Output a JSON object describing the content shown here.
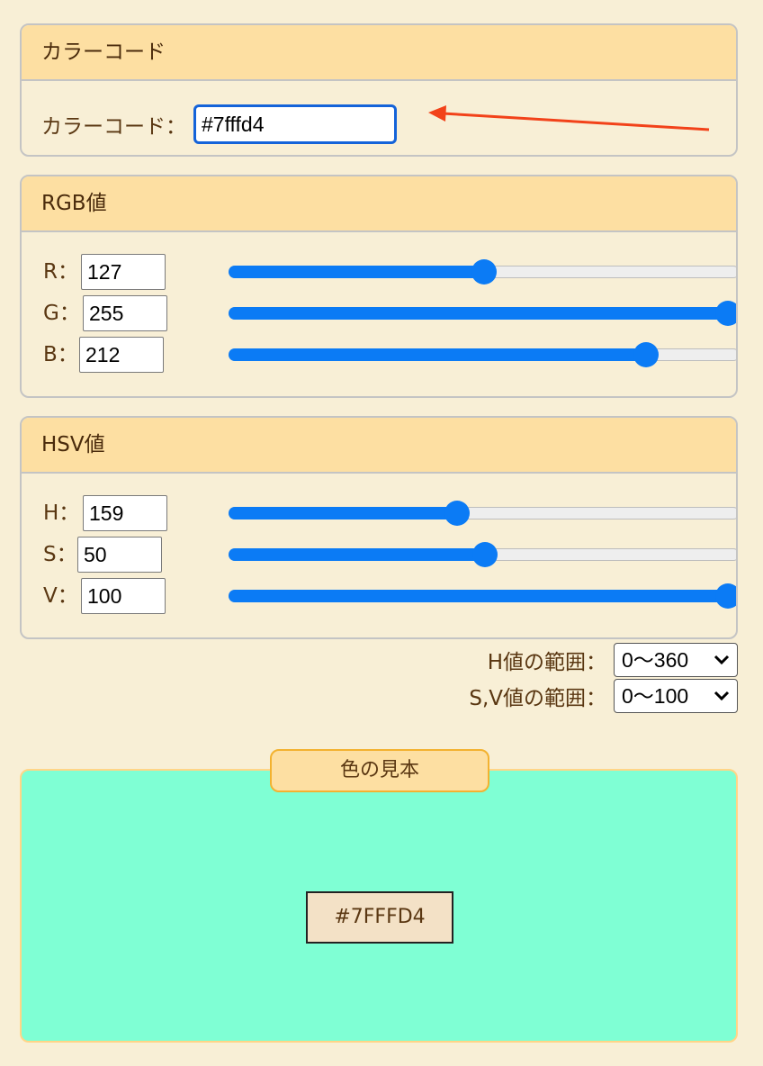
{
  "colors": {
    "panel_header_bg": "#fddfa2",
    "page_bg": "#f8efd6",
    "slider_accent": "#0b7bf5",
    "arrow": "#f2421a",
    "sample_color": "#7fffd4"
  },
  "color_code": {
    "header": "カラーコード",
    "label": "カラーコード：",
    "value": "#7fffd4"
  },
  "rgb": {
    "header": "RGB値",
    "rows": [
      {
        "label": "R：",
        "value": "127",
        "fraction": 0.498
      },
      {
        "label": "G：",
        "value": "255",
        "fraction": 1.0
      },
      {
        "label": "B：",
        "value": "212",
        "fraction": 0.831
      }
    ]
  },
  "hsv": {
    "header": "HSV値",
    "rows": [
      {
        "label": "H：",
        "value": "159",
        "fraction": 0.442
      },
      {
        "label": "S：",
        "value": "50",
        "fraction": 0.5
      },
      {
        "label": "V：",
        "value": "100",
        "fraction": 1.0
      }
    ]
  },
  "ranges": {
    "h_label": "H値の範囲：",
    "h_selected": "0〜360",
    "sv_label": "S,V値の範囲：",
    "sv_selected": "0〜100"
  },
  "sample": {
    "tab_label": "色の見本",
    "code": "#7FFFD4"
  },
  "icons": {
    "select_chevron": "chevron-down-icon",
    "annotation_arrow": "arrow-left-icon"
  }
}
